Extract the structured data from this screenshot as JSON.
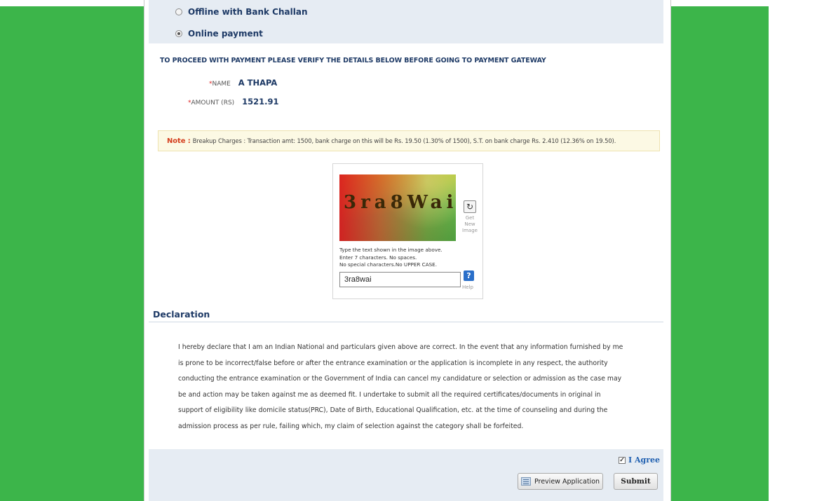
{
  "payment": {
    "options": [
      {
        "label": "Offline with Bank Challan",
        "selected": false
      },
      {
        "label": "Online payment",
        "selected": true
      }
    ]
  },
  "verify": {
    "title": "TO PROCEED WITH PAYMENT PLEASE VERIFY THE DETAILS BELOW BEFORE GOING TO PAYMENT GATEWAY",
    "name_label": "NAME",
    "name_value": "A THAPA",
    "amount_label": "AMOUNT (RS)",
    "amount_value": "1521.91",
    "required_mark": "*"
  },
  "note": {
    "label": "Note :",
    "text": "Breakup Charges : Transaction amt: 1500, bank charge on this will be Rs. 19.50 (1.30% of 1500), S.T. on bank charge Rs. 2.410 (12.36% on 19.50)."
  },
  "captcha": {
    "image_text": "3ra8Wai",
    "refresh_label": "Get New Image",
    "instructions": [
      "Type the text shown in the image above.",
      "Enter 7 characters. No spaces.",
      "No special characters.No UPPER CASE."
    ],
    "input_value": "3ra8wai",
    "help_label": "Help"
  },
  "declaration": {
    "title": "Declaration",
    "text": "I hereby declare that I am an Indian National and particulars given above are correct. In the event that any information furnished by me is prone to be incorrect/false before or after the entrance examination or the application is incomplete in any respect, the authority conducting the entrance examination or the Government of India can cancel my candidature or selection or admission as the case may be and action may be taken against me as deemed fit. I undertake to submit all the required certificates/documents in original in support of eligibility like domicile status(PRC), Date of Birth, Educational Qualification, etc. at the time of counseling and during the admission process as per rule, failing which, my claim of selection against the category shall be forfeited."
  },
  "actions": {
    "agree_label": "I Agree",
    "agree_checked": true,
    "preview_label": "Preview Application",
    "submit_label": "Submit"
  },
  "colors": {
    "background": "#3cb54a",
    "heading": "#1e3a66",
    "note_label": "#d43e1e",
    "agree": "#1f5fb0"
  }
}
